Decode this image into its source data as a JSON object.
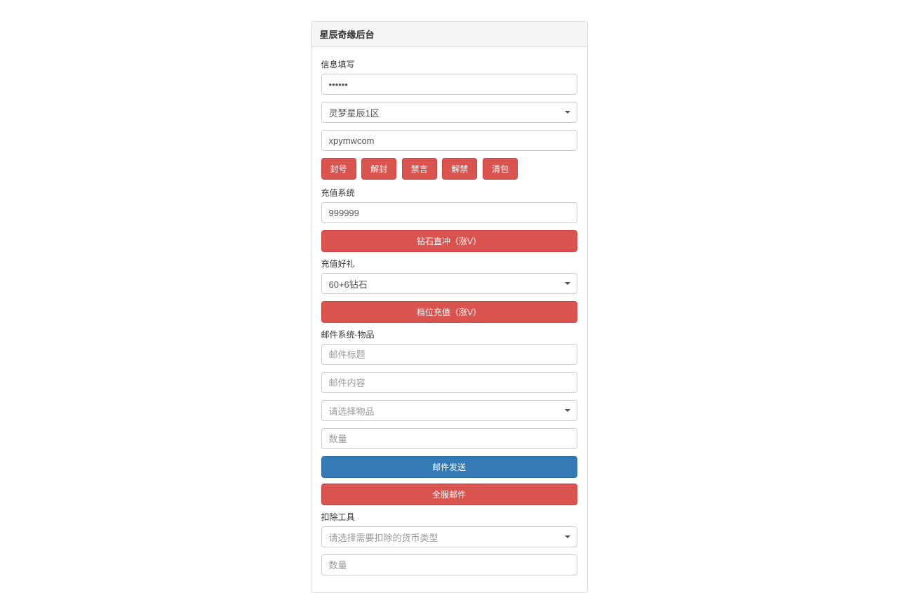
{
  "header": {
    "title": "星辰奇缘后台"
  },
  "info": {
    "label": "信息填写",
    "password_value": "......",
    "server_selected": "灵梦星辰1区",
    "username_value": "xpymwcom"
  },
  "actions": {
    "ban": "封号",
    "unban": "解封",
    "mute": "禁言",
    "unmute": "解禁",
    "clear_bag": "清包"
  },
  "recharge": {
    "label": "充值系统",
    "amount_value": "999999",
    "diamond_button": "钻石直冲（涨V）"
  },
  "gift": {
    "label": "充值好礼",
    "selected": "60+6钻石",
    "tier_button": "档位充值（涨V）"
  },
  "mail": {
    "label": "邮件系统-物品",
    "title_placeholder": "邮件标题",
    "content_placeholder": "邮件内容",
    "item_placeholder": "请选择物品",
    "quantity_placeholder": "数量",
    "send_button": "邮件发送",
    "broadcast_button": "全服邮件"
  },
  "deduct": {
    "label": "扣除工具",
    "currency_placeholder": "请选择需要扣除的货币类型",
    "quantity_placeholder": "数量"
  }
}
